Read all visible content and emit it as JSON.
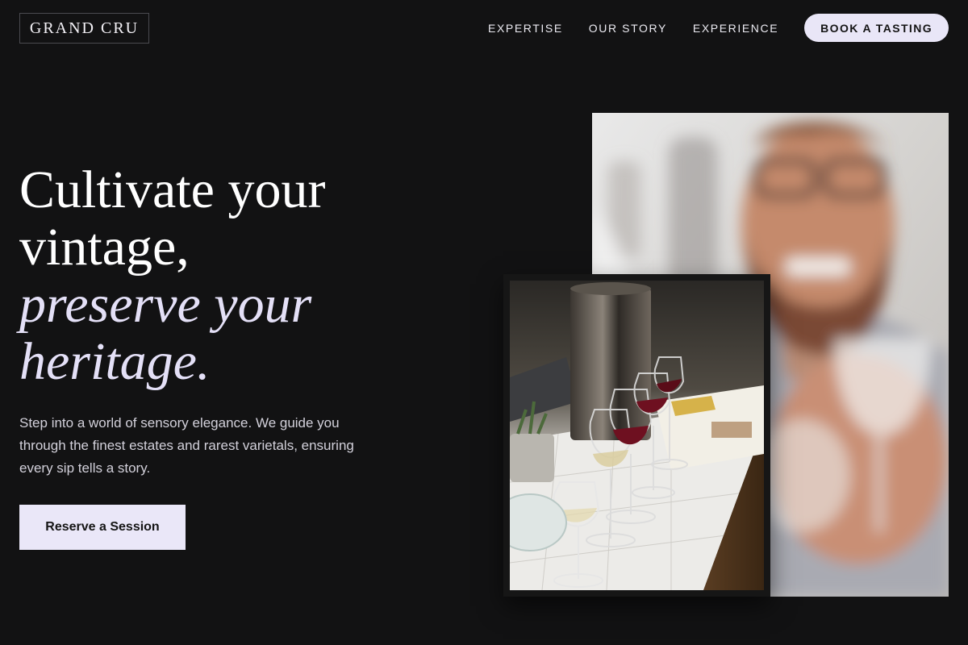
{
  "brand": {
    "logo": "GRAND CRU"
  },
  "nav": {
    "links": [
      "EXPERTISE",
      "OUR STORY",
      "EXPERIENCE"
    ],
    "cta": "BOOK A TASTING"
  },
  "hero": {
    "title_lines": [
      "Cultivate your",
      "vintage,"
    ],
    "title_accent_lines": [
      "preserve your",
      "heritage."
    ],
    "description": "Step into a world of sensory elegance. We guide you through the finest estates and rarest varietals, ensuring every sip tells a story.",
    "button": "Reserve a Session"
  },
  "images": {
    "large": {
      "subject": "sommelier-holding-wine-glass"
    },
    "small": {
      "subject": "wine-tasting-table-glasses"
    }
  }
}
